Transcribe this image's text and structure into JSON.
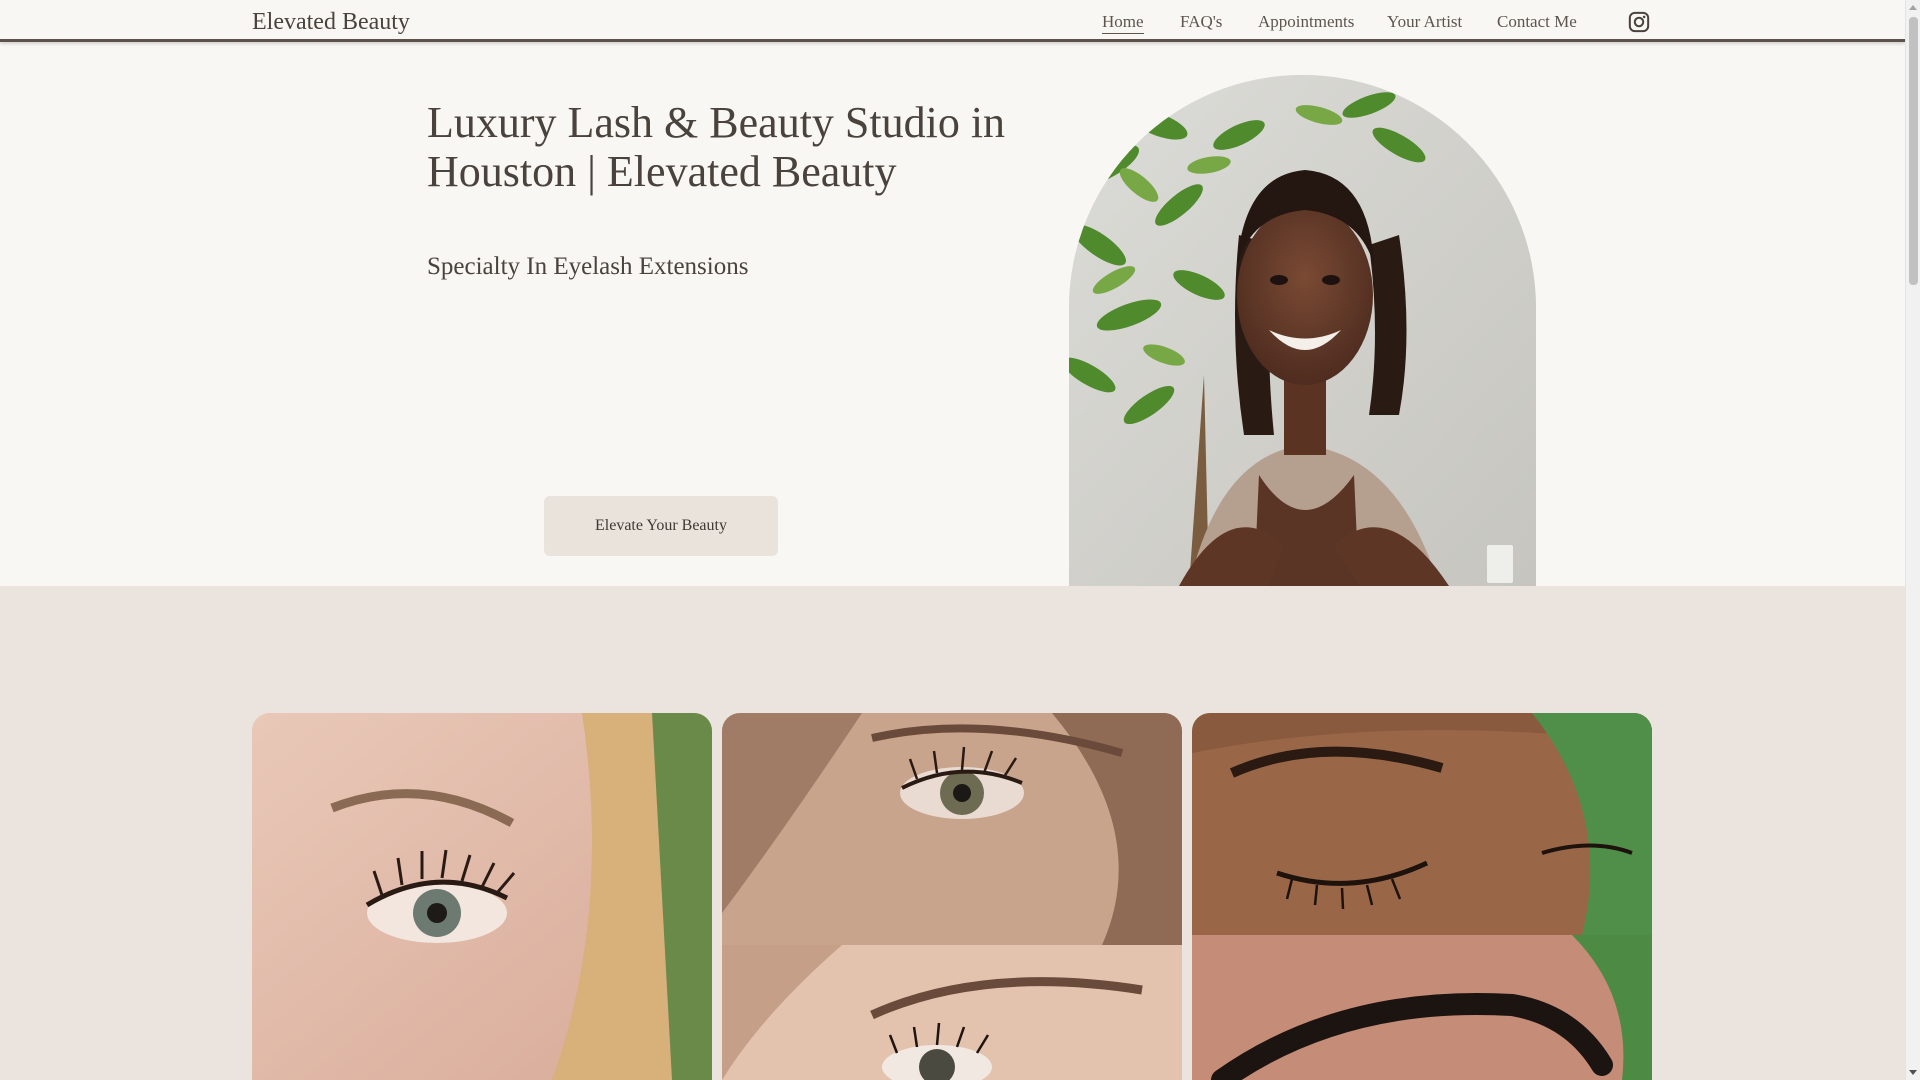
{
  "header": {
    "brand": "Elevated Beauty",
    "nav": [
      {
        "label": "Home",
        "active": true
      },
      {
        "label": "FAQ's",
        "active": false
      },
      {
        "label": "Appointments",
        "active": false
      },
      {
        "label": "Your Artist",
        "active": false
      },
      {
        "label": "Contact Me",
        "active": false
      }
    ],
    "social_icon": "instagram-icon"
  },
  "hero": {
    "title": "Luxury Lash & Beauty Studio in Houston | Elevated Beauty",
    "subtitle": "Specialty In Eyelash Extensions",
    "cta_label": "Elevate Your Beauty"
  },
  "gallery": {
    "images": [
      "lash-closeup-1",
      "lash-closeup-2",
      "lash-closeup-3",
      "brow-closeup-4",
      "brow-closeup-5"
    ]
  },
  "colors": {
    "background": "#f9f7f3",
    "section_bg": "#ebe4de",
    "text": "#4a423c",
    "button": "#e9e3dc",
    "header_border": "#5a524b"
  }
}
